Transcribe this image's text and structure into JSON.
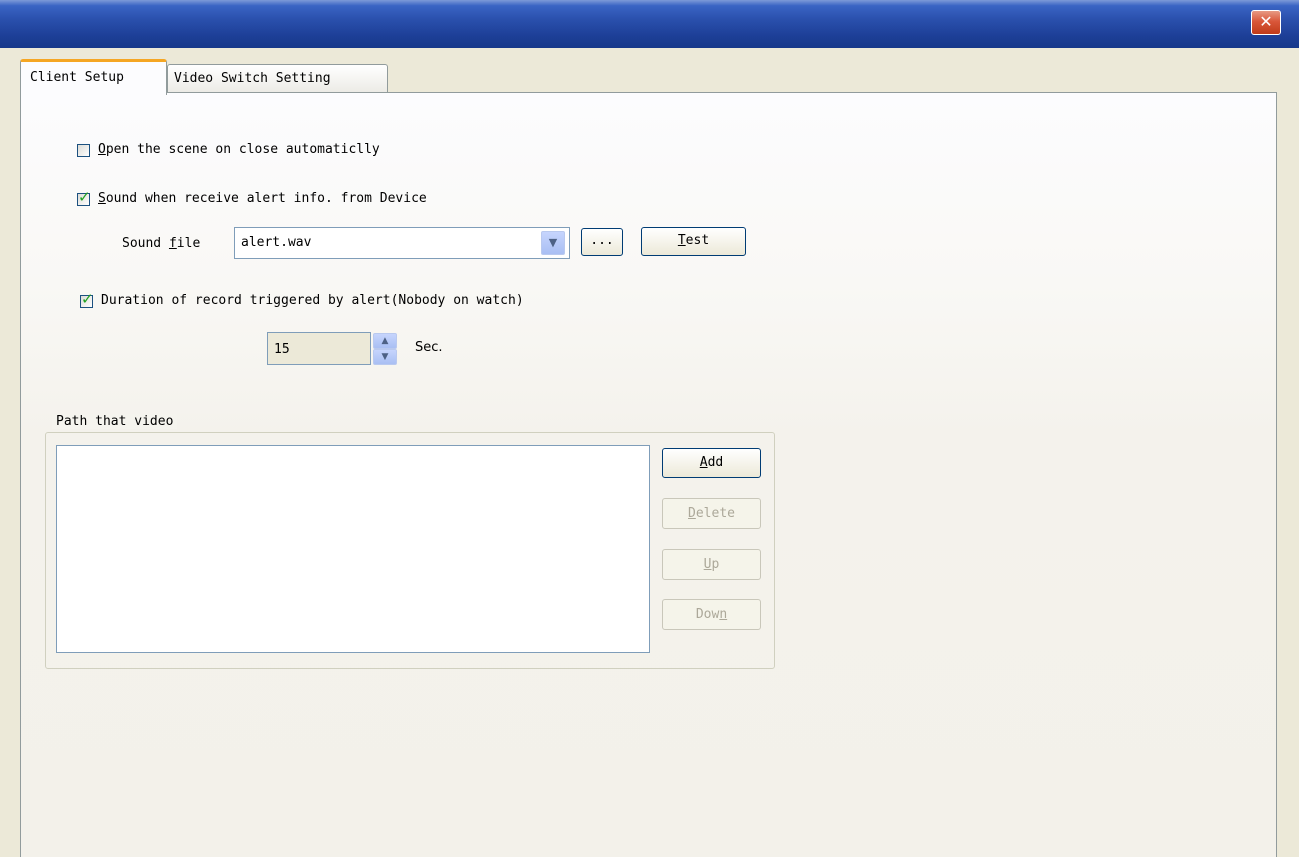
{
  "window": {
    "title": "",
    "close_label": "✕"
  },
  "tabs": [
    {
      "label": "Client Setup",
      "active": true
    },
    {
      "label": "Video Switch Setting",
      "active": false
    }
  ],
  "client_setup": {
    "open_scene": {
      "label": "Open the scene on close automaticlly",
      "checked": false
    },
    "sound_alert": {
      "label": "Sound when receive alert info. from Device",
      "checked": true
    },
    "sound_file": {
      "label": "Sound file",
      "value": "alert.wav"
    },
    "browse_label": "...",
    "test_label": "Test",
    "duration": {
      "label": "Duration of record triggered by alert(Nobody on watch)",
      "checked": true
    },
    "duration_value": "15",
    "duration_unit": "Sec.",
    "path_group": {
      "title": "Path that video",
      "items": [],
      "add_label": "Add",
      "delete_label": "Delete",
      "up_label": "Up",
      "down_label": "Down"
    }
  },
  "colors": {
    "titlebar": "#1d3f97",
    "close_button": "#d9573a",
    "check_mark": "#21a121",
    "tab_highlight": "#f5a623"
  },
  "icons": {
    "close": "close-icon",
    "check": "checkmark-icon",
    "dropdown": "chevron-down-icon",
    "spin_up": "arrow-up-icon",
    "spin_down": "arrow-down-icon"
  }
}
